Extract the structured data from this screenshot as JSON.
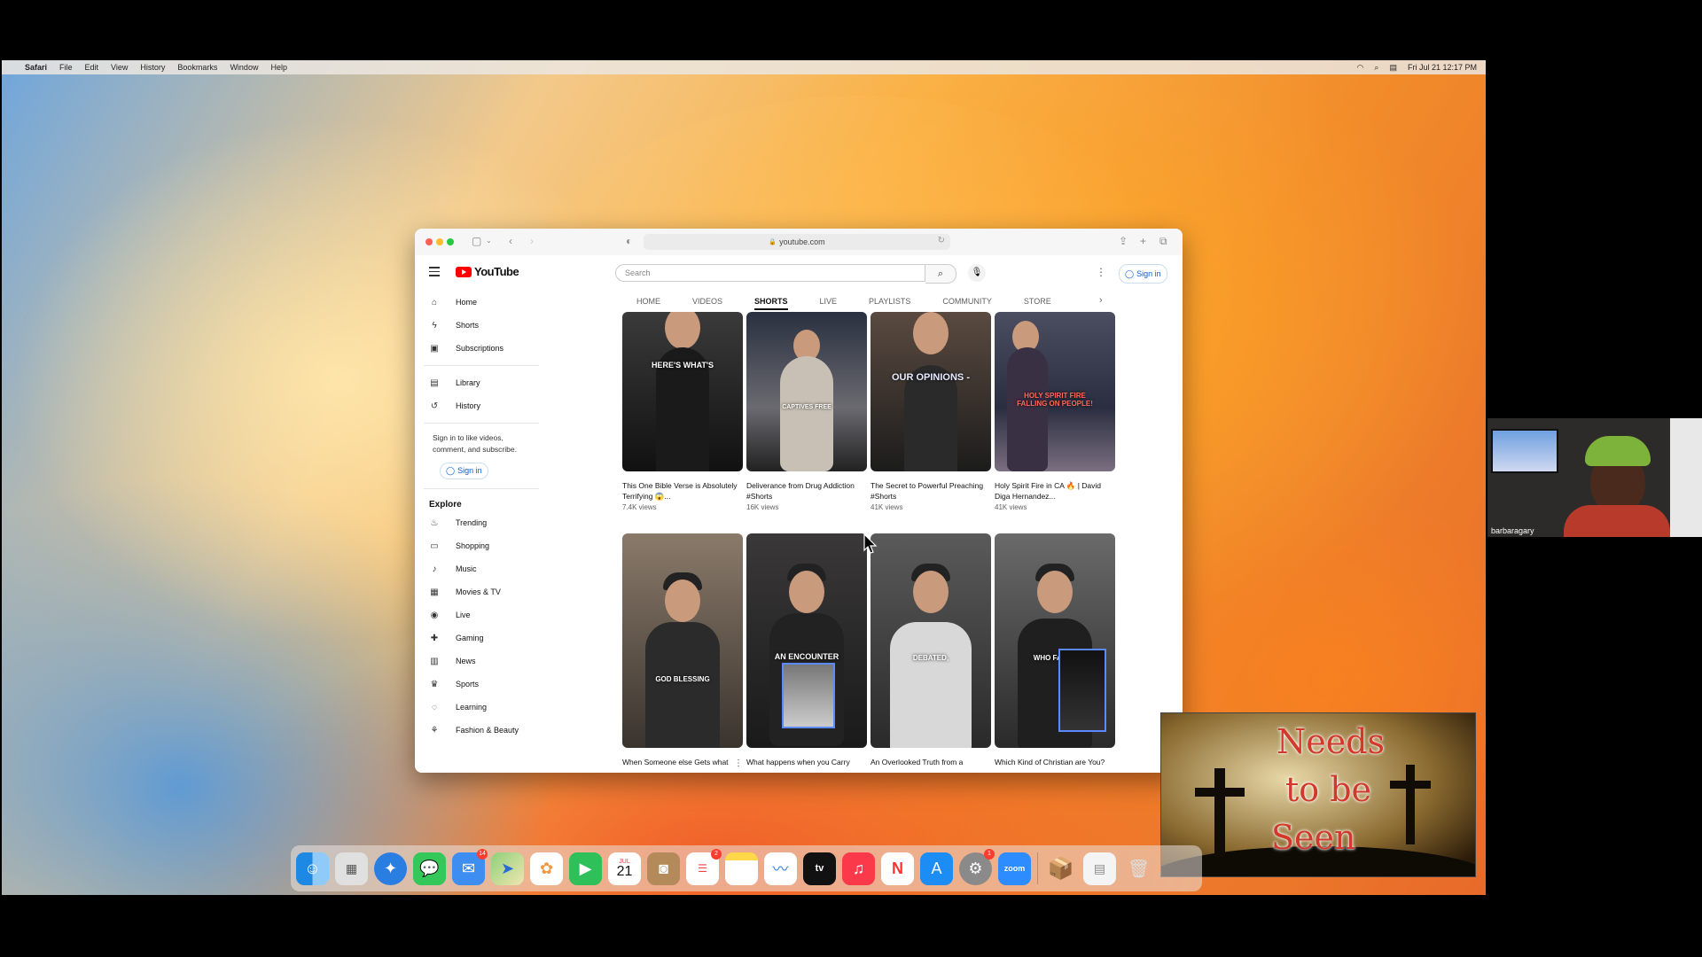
{
  "menubar": {
    "app": "Safari",
    "items": [
      "File",
      "Edit",
      "View",
      "History",
      "Bookmarks",
      "Window",
      "Help"
    ],
    "datetime": "Fri Jul 21  12:17 PM"
  },
  "safari": {
    "url": "youtube.com"
  },
  "youtube": {
    "logo_text": "YouTube",
    "search_placeholder": "Search",
    "signin_label": "Sign in",
    "sidebar": {
      "main": [
        {
          "label": "Home",
          "icon": "home-icon"
        },
        {
          "label": "Shorts",
          "icon": "shorts-icon"
        },
        {
          "label": "Subscriptions",
          "icon": "subscriptions-icon"
        }
      ],
      "library": [
        {
          "label": "Library",
          "icon": "library-icon"
        },
        {
          "label": "History",
          "icon": "history-icon"
        }
      ],
      "signin_prompt": "Sign in to like videos, comment, and subscribe.",
      "signin_label": "Sign in",
      "explore_heading": "Explore",
      "explore": [
        {
          "label": "Trending",
          "icon": "trending-icon"
        },
        {
          "label": "Shopping",
          "icon": "shopping-icon"
        },
        {
          "label": "Music",
          "icon": "music-icon"
        },
        {
          "label": "Movies & TV",
          "icon": "movies-icon"
        },
        {
          "label": "Live",
          "icon": "live-icon"
        },
        {
          "label": "Gaming",
          "icon": "gaming-icon"
        },
        {
          "label": "News",
          "icon": "news-icon"
        },
        {
          "label": "Sports",
          "icon": "sports-icon"
        },
        {
          "label": "Learning",
          "icon": "learning-icon"
        },
        {
          "label": "Fashion & Beauty",
          "icon": "fashion-icon"
        }
      ]
    },
    "tabs": [
      "HOME",
      "VIDEOS",
      "SHORTS",
      "LIVE",
      "PLAYLISTS",
      "COMMUNITY",
      "STORE"
    ],
    "active_tab": "SHORTS",
    "shorts_row1": [
      {
        "caption": "HERE'S WHAT'S",
        "title": "This One Bible Verse is Absolutely Terrifying 😱...",
        "views": "7.4K views"
      },
      {
        "caption": "CAPTIVES FREE",
        "title": "Deliverance from Drug Addiction #Shorts",
        "views": "16K views"
      },
      {
        "caption": "OUR OPINIONS -",
        "title": "The Secret to Powerful Preaching #Shorts",
        "views": "41K views"
      },
      {
        "caption": "HOLY SPIRIT FIRE FALLING ON PEOPLE!",
        "title": "Holy Spirit Fire in CA 🔥 | David Diga Hernandez...",
        "views": "41K views"
      }
    ],
    "shorts_row2": [
      {
        "caption": "GOD BLESSING",
        "title": "When Someone else Gets what You Prayed for #Shorts"
      },
      {
        "caption": "AN ENCOUNTER",
        "title": "What happens when you Carry God's Glory #Shorts"
      },
      {
        "caption": "DEBATED,",
        "title": "An Overlooked Truth from a Popular Bible verse #Shorts"
      },
      {
        "caption": "WHO FACES",
        "title": "Which Kind of Christian are You? #Shorts"
      }
    ]
  },
  "zoom": {
    "participant_name": "barbaragary",
    "overlay_text": [
      "Needs",
      "to be",
      "Seen"
    ]
  },
  "dock": {
    "calendar_month": "JUL",
    "calendar_day": "21",
    "mail_badge": "14",
    "reminders_badge": "2",
    "settings_badge": "1",
    "zoom_label": "zoom",
    "tv_label": "tv"
  },
  "colors": {
    "youtube_red": "#ff0000",
    "link_blue": "#065fd4"
  }
}
